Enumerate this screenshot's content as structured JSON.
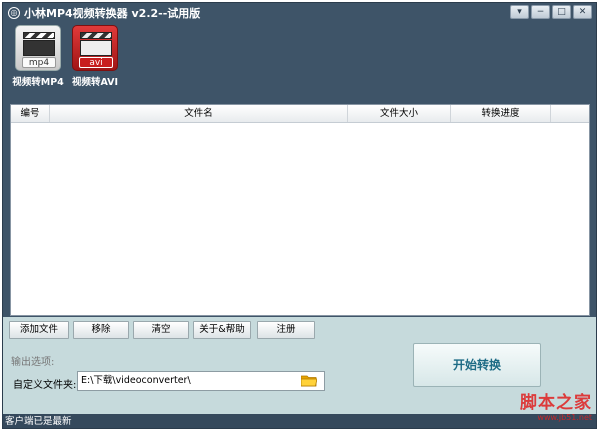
{
  "window": {
    "title": "小林MP4视频转换器 v2.2--试用版",
    "app_icon_glyph": "◎",
    "controls": [
      "▾",
      "−",
      "□",
      "✕"
    ]
  },
  "toolbar": {
    "tools": [
      {
        "label": "视频转MP4",
        "icon": "mp4-clapper-icon",
        "tag": "mp4"
      },
      {
        "label": "视频转AVI",
        "icon": "avi-clapper-icon",
        "tag": "avi"
      }
    ]
  },
  "filelist": {
    "columns": [
      "编号",
      "文件名",
      "文件大小",
      "转换进度"
    ],
    "rows": []
  },
  "actions": {
    "add_file": "添加文件",
    "remove": "移除",
    "clear": "清空",
    "about_help": "关于&帮助",
    "register": "注册"
  },
  "output": {
    "section_title": "输出选项:",
    "folder_label": "自定义文件夹:",
    "folder_path": "E:\\下载\\videoconverter\\",
    "folder_icon": "folder-icon"
  },
  "start_button": "开始转换",
  "status": {
    "text": "客户端已是最新"
  },
  "watermark": {
    "text": "脚本之家",
    "url": "www.jb51.net"
  },
  "colors": {
    "frame": "#3e5468",
    "bottom_panel": "#c6dadc",
    "accent": "#1d6b85",
    "watermark": "#e02020"
  }
}
